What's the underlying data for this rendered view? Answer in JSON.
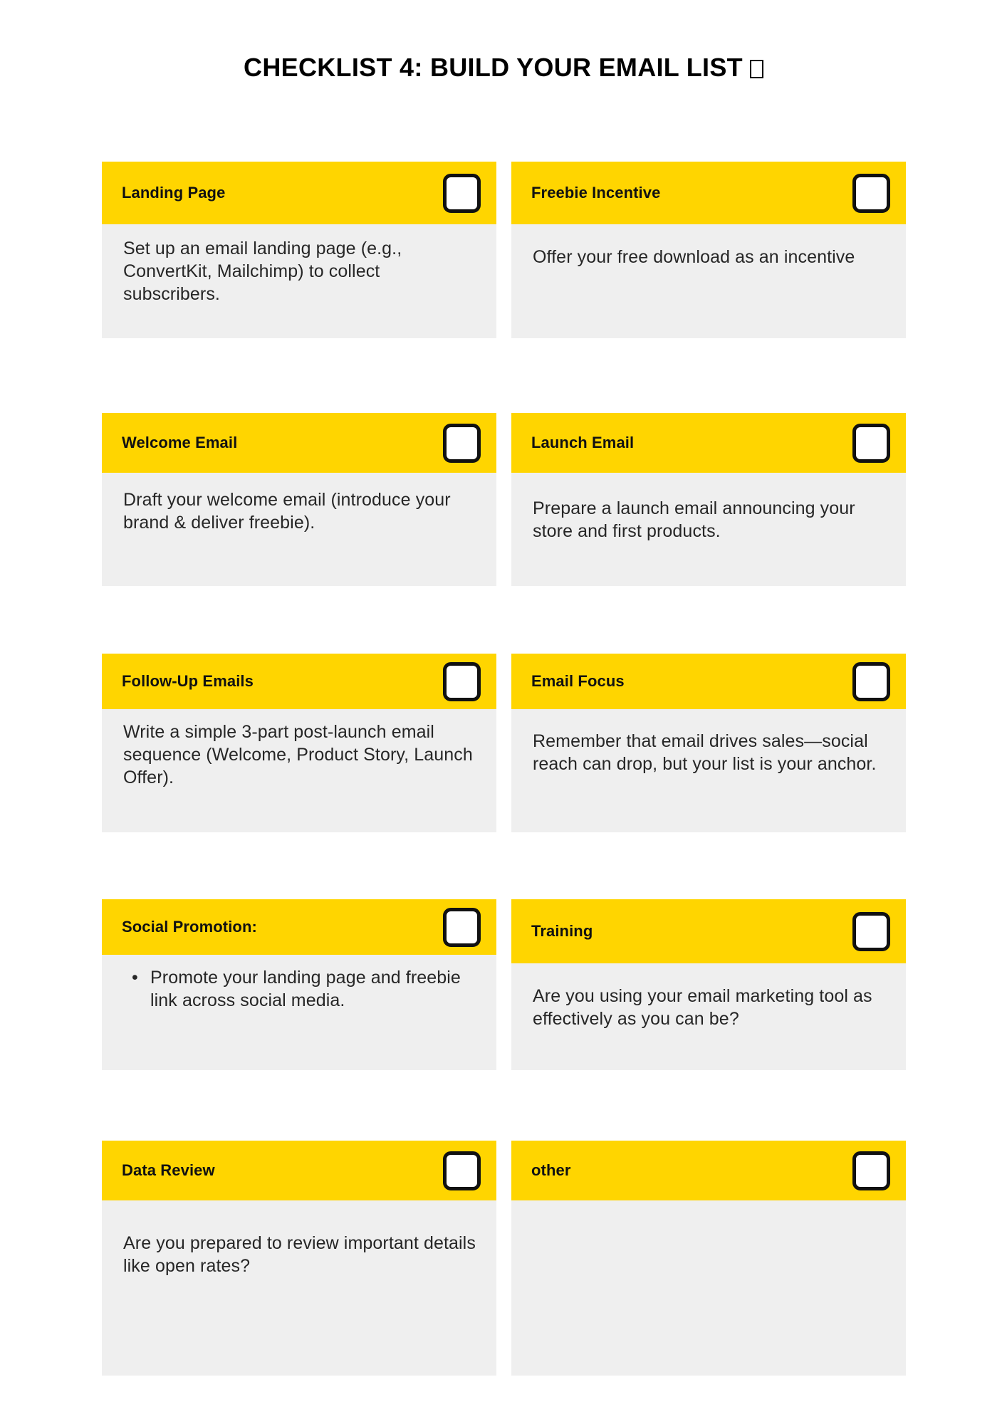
{
  "title": {
    "text": "CHECKLIST 4: BUILD YOUR EMAIL LIST",
    "trailing_glyph": "□"
  },
  "colors": {
    "header_yellow": "#ffd500",
    "body_gray": "#efefef",
    "text_black": "#1a1a1a",
    "page_background": "#ffffff"
  },
  "cards": [
    {
      "id": "landing-page",
      "title": "Landing Page",
      "body": "Set up an email landing page (e.g., ConvertKit, Mailchimp) to collect subscribers.",
      "checkbox_checked": false
    },
    {
      "id": "freebie-incentive",
      "title": "Freebie Incentive",
      "body": "Offer your free download as an incentive",
      "checkbox_checked": false
    },
    {
      "id": "welcome-email",
      "title": "Welcome Email",
      "body": "Draft your welcome email (introduce your brand & deliver freebie).",
      "checkbox_checked": false
    },
    {
      "id": "launch-email",
      "title": "Launch Email",
      "body": "Prepare a launch email announcing your store and first products.",
      "checkbox_checked": false
    },
    {
      "id": "follow-up-emails",
      "title": "Follow-Up Emails",
      "body": "Write a simple 3-part post-launch email sequence (Welcome, Product Story, Launch Offer).",
      "checkbox_checked": false
    },
    {
      "id": "email-focus",
      "title": "Email Focus",
      "body": "Remember that email drives sales—social reach can drop, but your list is your anchor.",
      "checkbox_checked": false
    },
    {
      "id": "social-promotion",
      "title": "Social Promotion:",
      "body_bullets": [
        "Promote your landing page and freebie link across social media."
      ],
      "checkbox_checked": false
    },
    {
      "id": "training",
      "title": "Training",
      "body": "Are you using your email marketing tool as effectively as you can be?",
      "checkbox_checked": false
    },
    {
      "id": "data-review",
      "title": "Data Review",
      "body": "Are you prepared to review important details like open rates?",
      "checkbox_checked": false
    },
    {
      "id": "other",
      "title": "other",
      "body": "",
      "checkbox_checked": false
    }
  ]
}
